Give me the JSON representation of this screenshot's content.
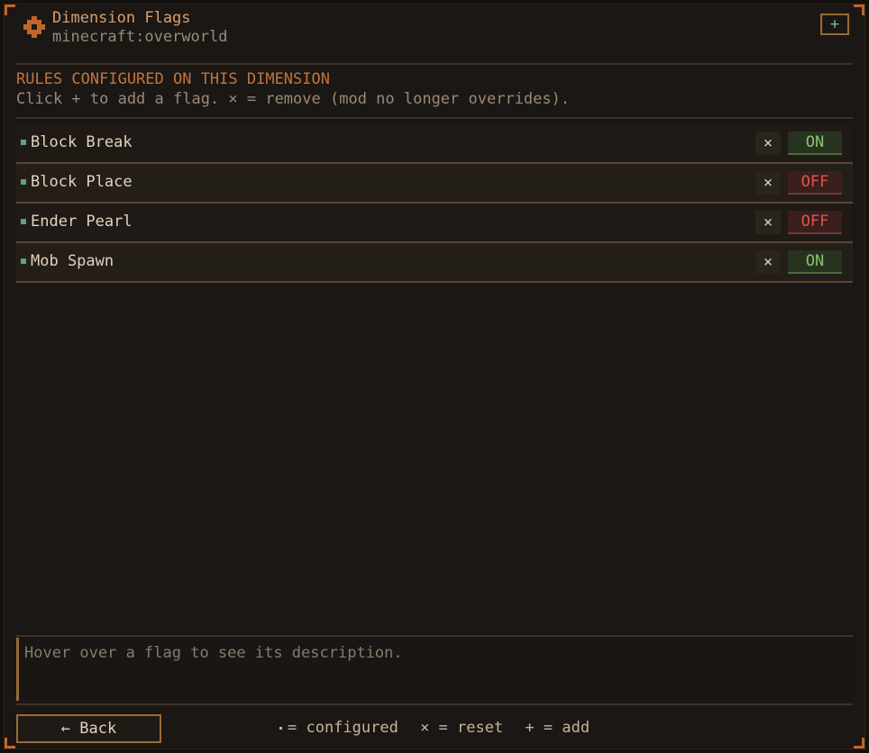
{
  "header": {
    "title": "Dimension Flags",
    "subtitle": "minecraft:overworld",
    "add_label": "+",
    "logo_icon": "gear-icon"
  },
  "section": {
    "title": "RULES CONFIGURED ON THIS DIMENSION",
    "help": "Click + to add a flag. × = remove (mod no longer overrides)."
  },
  "flags": [
    {
      "name": "Block Break",
      "remove_label": "×",
      "state": "ON"
    },
    {
      "name": "Block Place",
      "remove_label": "×",
      "state": "OFF"
    },
    {
      "name": "Ender Pearl",
      "remove_label": "×",
      "state": "OFF"
    },
    {
      "name": "Mob Spawn",
      "remove_label": "×",
      "state": "ON"
    }
  ],
  "description": {
    "placeholder": "Hover over a flag to see its description."
  },
  "footer": {
    "back_label": "← Back",
    "legend_configured": "= configured",
    "legend_reset": "× = reset",
    "legend_add": "+ = add"
  },
  "colors": {
    "accent": "#c0652c",
    "on": "#8cc06e",
    "off": "#e0564a",
    "marker": "#5fa37d"
  }
}
